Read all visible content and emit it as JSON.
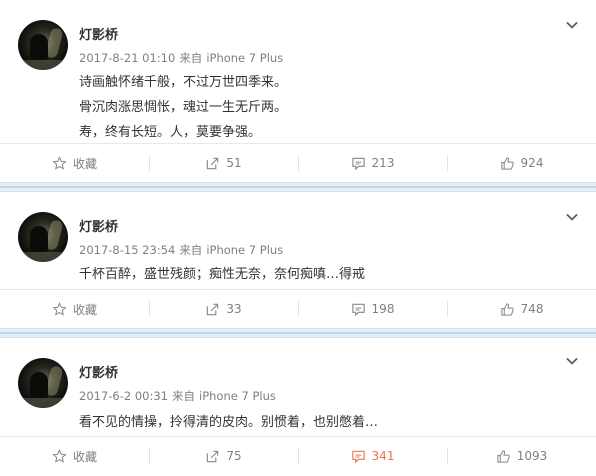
{
  "posts": [
    {
      "username": "灯影桥",
      "date": "2017-8-21 01:10",
      "source_prefix": "来自",
      "source": "iPhone 7 Plus",
      "lines": [
        "诗画触怀绪千般，不过万世四季来。",
        "骨沉肉涨思惆怅，魂过一生无斤两。",
        "寿，终有长短。人，莫要争强。"
      ],
      "actions": {
        "favorite_label": "收藏",
        "repost_count": "51",
        "comment_count": "213",
        "like_count": "924"
      }
    },
    {
      "username": "灯影桥",
      "date": "2017-8-15 23:54",
      "source_prefix": "来自",
      "source": "iPhone 7 Plus",
      "lines": [
        "千杯百醉，盛世残颜；痴性无奈，奈何痴嗔…得戒"
      ],
      "actions": {
        "favorite_label": "收藏",
        "repost_count": "33",
        "comment_count": "198",
        "like_count": "748"
      }
    },
    {
      "username": "灯影桥",
      "date": "2017-6-2 00:31",
      "source_prefix": "来自",
      "source": "iPhone 7 Plus",
      "lines": [
        "看不见的情操，拎得清的皮肉。别惯着，也别憋着…"
      ],
      "actions": {
        "favorite_label": "收藏",
        "repost_count": "75",
        "comment_count": "341",
        "like_count": "1093"
      }
    }
  ],
  "colors": {
    "highlight": "#eb7350",
    "separator": "#e6eef6",
    "meta": "#808080"
  },
  "icons": {
    "more": "chevron-down-icon",
    "favorite": "star-icon",
    "repost": "repost-icon",
    "comment": "comment-icon",
    "like": "thumbs-up-icon"
  }
}
